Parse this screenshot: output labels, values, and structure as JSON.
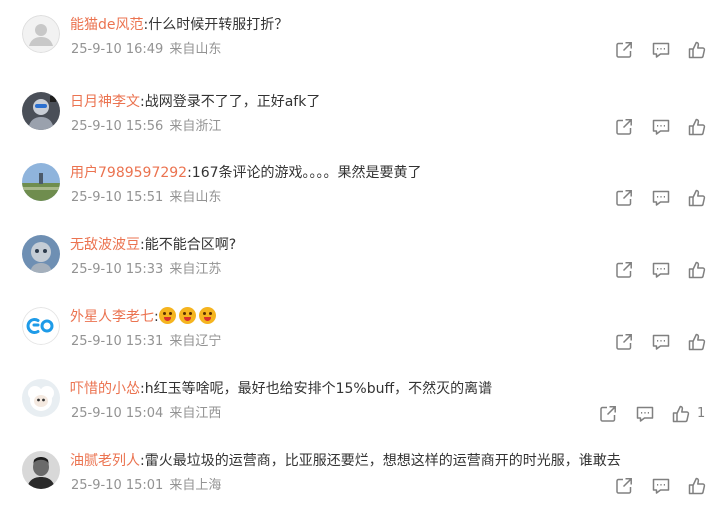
{
  "comments": [
    {
      "user": "能猫de风范",
      "text": ":什么时候开转服打折？",
      "emojis": [],
      "date": "25-9-10 16:49",
      "source": "来自山东",
      "likes": "",
      "avatar": "default-gray"
    },
    {
      "user": "日月神李文",
      "text": ":战网登录不了了，正好afk了",
      "emojis": [],
      "date": "25-9-10 15:56",
      "source": "来自浙江",
      "likes": "",
      "avatar": "robot-dark"
    },
    {
      "user": "用户7989597292",
      "text": ":167条评论的游戏。。。。果然是要黄了",
      "emojis": [],
      "date": "25-9-10 15:51",
      "source": "来自山东",
      "likes": "",
      "avatar": "landscape"
    },
    {
      "user": "无敌波波豆",
      "text": ":能不能合区啊?",
      "emojis": [],
      "date": "25-9-10 15:33",
      "source": "来自江苏",
      "likes": "",
      "avatar": "robot-silver"
    },
    {
      "user": "外星人李老七",
      "text": ":",
      "emojis": [
        "smile-emoji",
        "smile-emoji",
        "smile-emoji"
      ],
      "date": "25-9-10 15:31",
      "source": "来自辽宁",
      "likes": "",
      "avatar": "logo-blue"
    },
    {
      "user": "吓惜的小怂",
      "text": ":h红玉等啥呢，最好也给安排个15%buff，不然灭的离谱",
      "emojis": [],
      "date": "25-9-10 15:04",
      "source": "来自江西",
      "likes": "1",
      "avatar": "sheep-white"
    },
    {
      "user": "油腻老列人",
      "text": ":雷火最垃圾的运营商，比亚服还要烂，想想这样的运营商开的时光服，谁敢去",
      "emojis": [],
      "date": "25-9-10 15:01",
      "source": "来自上海",
      "likes": "",
      "avatar": "bw-portrait"
    }
  ],
  "icons": {
    "share": "share-icon",
    "comment": "comment-icon",
    "like": "thumbs-up-icon"
  },
  "colors": {
    "username": "#eb7350",
    "text": "#333333",
    "meta": "#939393",
    "icon": "#808080"
  }
}
